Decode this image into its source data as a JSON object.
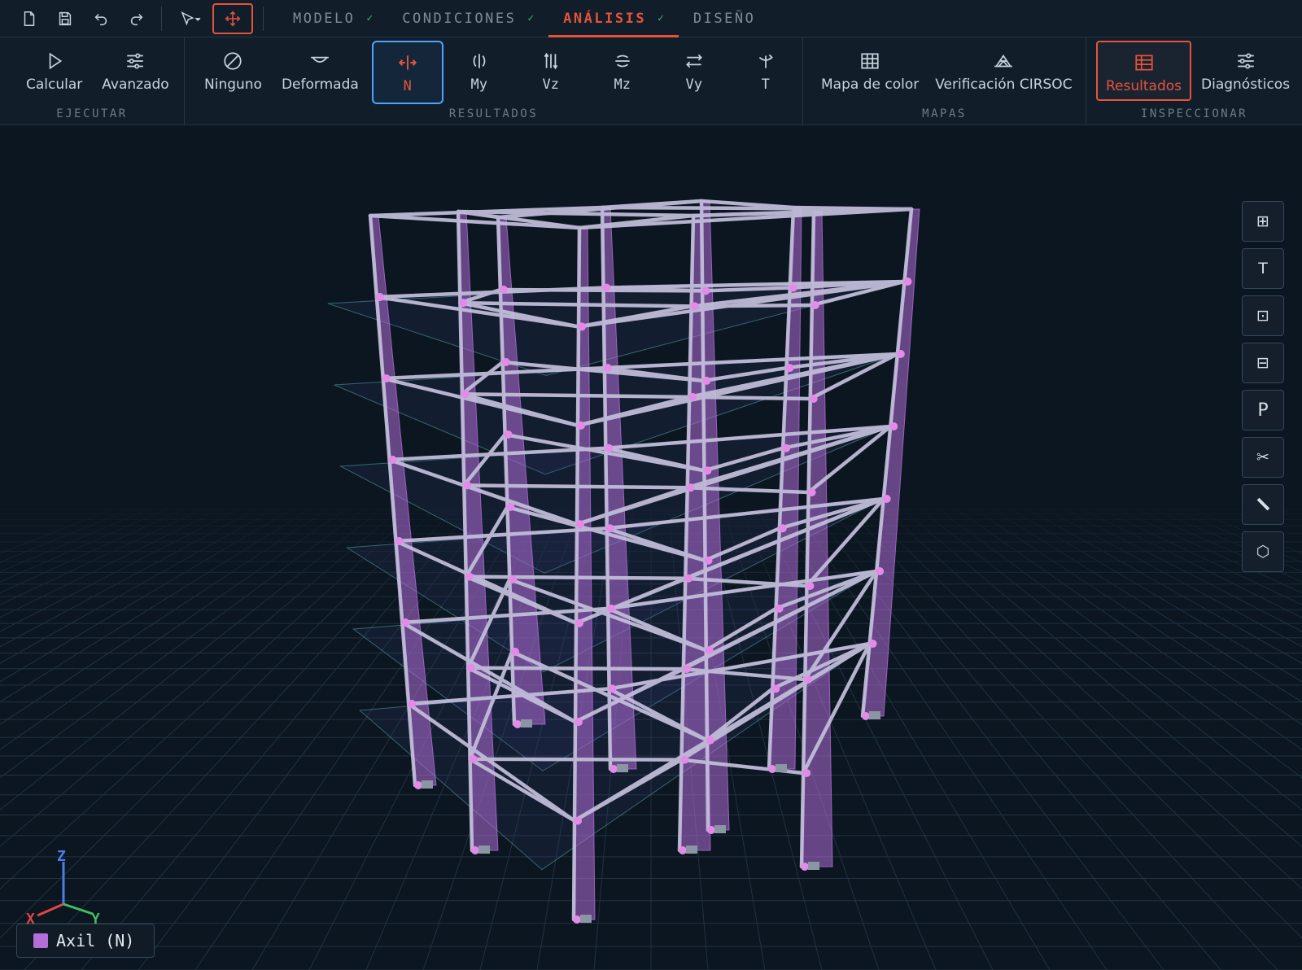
{
  "toolbar": {
    "icons": [
      "new-file-icon",
      "save-icon",
      "undo-icon",
      "redo-icon",
      "select-arrow-icon",
      "move-icon"
    ]
  },
  "tabs": [
    {
      "label": "MODELO",
      "check": "✓",
      "active": false
    },
    {
      "label": "CONDICIONES",
      "check": "✓",
      "active": false
    },
    {
      "label": "ANÁLISIS",
      "check": "✓",
      "active": true
    },
    {
      "label": "DISEÑO",
      "check": "",
      "active": false
    }
  ],
  "ribbon": {
    "ejecutar": {
      "label": "EJECUTAR",
      "calcular": "Calcular",
      "avanzado": "Avanzado"
    },
    "resultados": {
      "label": "RESULTADOS",
      "ninguno": "Ninguno",
      "deformada": "Deformada",
      "n": "N",
      "my": "My",
      "vz": "Vz",
      "mz": "Mz",
      "vy": "Vy",
      "t": "T"
    },
    "mapas": {
      "label": "MAPAS",
      "mapa_color": "Mapa de color",
      "verificacion": "Verificación CIRSOC"
    },
    "inspeccionar": {
      "label": "INSPECCIONAR",
      "resultados": "Resultados",
      "diagnosticos": "Diagnósticos"
    }
  },
  "side_tools": {
    "grid": "⊞",
    "text": "T",
    "frame": "⊡",
    "section": "⊟",
    "p": "P",
    "cut": "✂",
    "measure": "▬",
    "shape": "⬡"
  },
  "axes": {
    "z": "Z",
    "x": "X",
    "y": "Y"
  },
  "legend": {
    "label": "Axil (N)",
    "color": "#b36ed8"
  },
  "colors": {
    "accent": "#e5533d",
    "selected_outline": "#4da3ff",
    "diagram": "#b36ed8",
    "frame": "#c9c3e0",
    "check": "#3fb57a"
  }
}
